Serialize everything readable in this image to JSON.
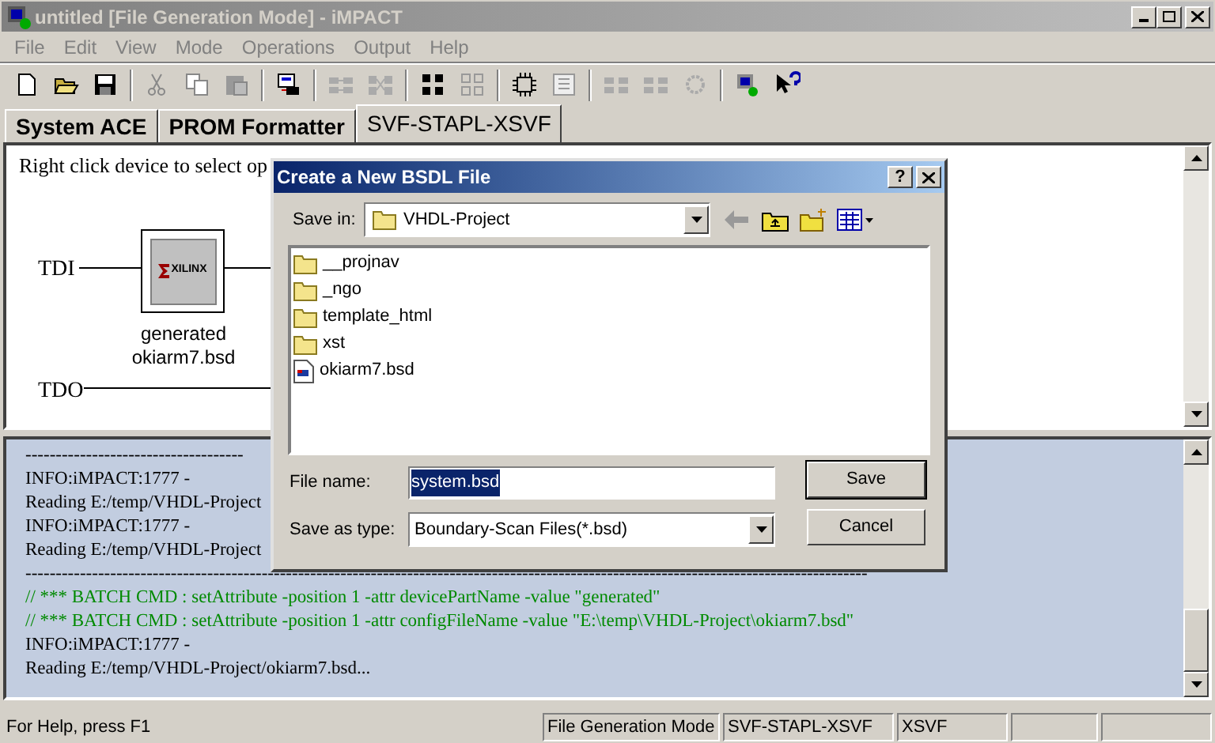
{
  "window": {
    "title": "untitled [File Generation Mode]  - iMPACT"
  },
  "menu": [
    "File",
    "Edit",
    "View",
    "Mode",
    "Operations",
    "Output",
    "Help"
  ],
  "tabs": [
    {
      "label": "System ACE",
      "selected": false
    },
    {
      "label": "PROM Formatter",
      "selected": false
    },
    {
      "label": "SVF-STAPL-XSVF",
      "selected": true
    }
  ],
  "canvas": {
    "hint": "Right click device to select op",
    "tdi": "TDI",
    "tdo": "TDO",
    "device": {
      "logo": "XILINX",
      "line_1": "generated",
      "line_2": "okiarm7.bsd"
    }
  },
  "log": [
    {
      "kind": "text",
      "text": "------------------------------------"
    },
    {
      "kind": "text",
      "text": "INFO:iMPACT:1777 -"
    },
    {
      "kind": "text",
      "text": "Reading E:/temp/VHDL-Project"
    },
    {
      "kind": "text",
      "text": "INFO:iMPACT:1777 -"
    },
    {
      "kind": "text",
      "text": "Reading E:/temp/VHDL-Project"
    },
    {
      "kind": "text",
      "text": "-------------------------------------------------------------------------------------------------------------------------------------------"
    },
    {
      "kind": "cmd",
      "text": "// *** BATCH CMD : setAttribute -position 1 -attr devicePartName -value \"generated\""
    },
    {
      "kind": "cmd",
      "text": "// *** BATCH CMD : setAttribute -position 1 -attr configFileName -value \"E:\\temp\\VHDL-Project\\okiarm7.bsd\""
    },
    {
      "kind": "text",
      "text": "INFO:iMPACT:1777 -"
    },
    {
      "kind": "text",
      "text": "Reading E:/temp/VHDL-Project/okiarm7.bsd..."
    }
  ],
  "status_bar": [
    "For Help, press F1",
    "File Generation Mode",
    "SVF-STAPL-XSVF",
    "XSVF"
  ],
  "dialog": {
    "title": "Create a New BSDL File",
    "help": "?",
    "save_in_label": "Save in:",
    "save_in": "VHDL-Project",
    "files": [
      {
        "kind": "folder",
        "name": "__projnav"
      },
      {
        "kind": "folder",
        "name": "_ngo"
      },
      {
        "kind": "folder",
        "name": "template_html"
      },
      {
        "kind": "folder",
        "name": "xst"
      },
      {
        "kind": "file",
        "name": "okiarm7.bsd"
      }
    ],
    "file_name_label": "File name:",
    "file_name": "system.bsd",
    "type_label": "Save as type:",
    "type": "Boundary-Scan Files(*.bsd)",
    "buttons": [
      "Save",
      "Cancel"
    ]
  }
}
